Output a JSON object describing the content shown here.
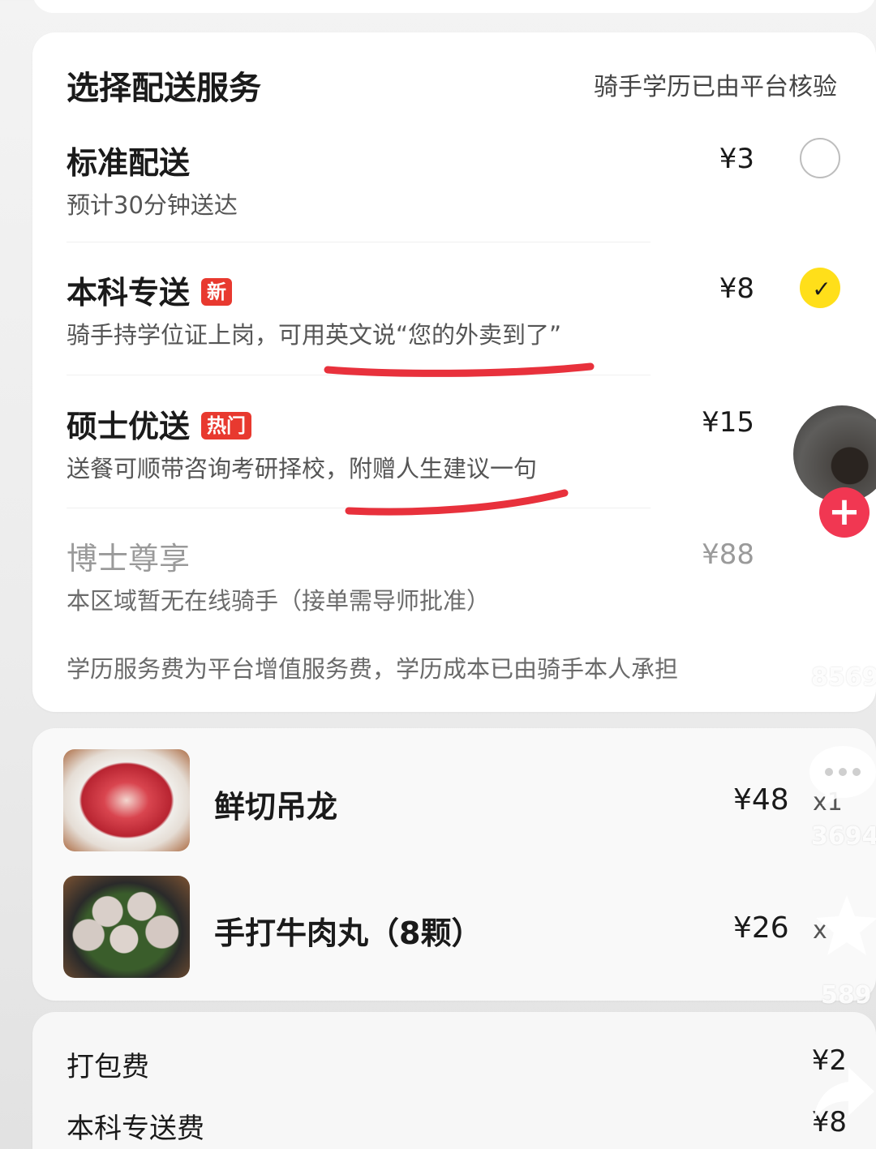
{
  "delivery": {
    "title": "选择配送服务",
    "note": "骑手学历已由平台核验",
    "options": [
      {
        "name": "标准配送",
        "desc": "预计30分钟送达",
        "price": "¥3",
        "badge": "",
        "selected": false,
        "available": true
      },
      {
        "name": "本科专送",
        "desc": "骑手持学位证上岗，可用英文说“您的外卖到了”",
        "price": "¥8",
        "badge": "新",
        "selected": true,
        "available": true
      },
      {
        "name": "硕士优送",
        "desc": "送餐可顺带咨询考研择校，附赠人生建议一句",
        "price": "¥15",
        "badge": "热门",
        "selected": false,
        "available": true
      },
      {
        "name": "博士尊享",
        "desc": "本区域暂无在线骑手（接单需导师批准）",
        "price": "¥88",
        "badge": "",
        "selected": false,
        "available": false
      }
    ],
    "footnote": "学历服务费为平台增值服务费，学历成本已由骑手本人承担",
    "check_glyph": "✓"
  },
  "items": [
    {
      "name": "鲜切吊龙",
      "price": "¥48",
      "qty": "x1"
    },
    {
      "name": "手打牛肉丸（8颗）",
      "price": "¥26",
      "qty": "x"
    }
  ],
  "fees": [
    {
      "label": "打包费",
      "value": "¥2"
    },
    {
      "label": "本科专送费",
      "value": "¥8"
    }
  ],
  "overlay": {
    "like_count": "8569",
    "comment_count": "3694",
    "favorite_count": "589",
    "follow_glyph": "+"
  },
  "colors": {
    "accent_yellow": "#ffdf1a",
    "badge_red": "#e8392f",
    "underline_red": "#e8313c",
    "follow_red": "#f13752"
  }
}
